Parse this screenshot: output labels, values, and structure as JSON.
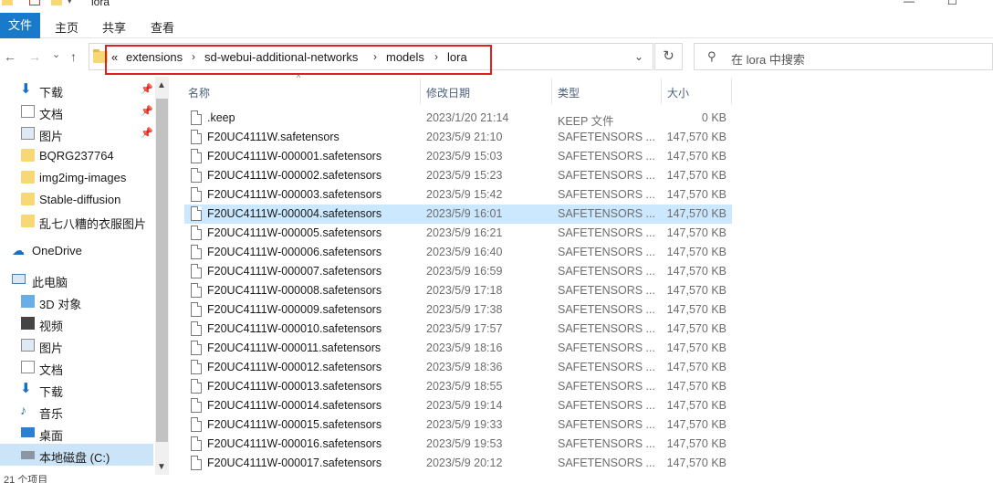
{
  "window": {
    "title": "lora",
    "minimize": "—",
    "maximize": "☐"
  },
  "ribbon": {
    "tabs": [
      "文件",
      "主页",
      "共享",
      "查看"
    ]
  },
  "nav": {
    "back": "←",
    "forward": "→",
    "recent": "⌄",
    "up": "↑",
    "breadcrumb": [
      "«",
      "extensions",
      "sd-webui-additional-networks",
      "models",
      "lora"
    ],
    "refresh": "↻",
    "search_placeholder": "在 lora 中搜索"
  },
  "sidebar": {
    "quick_access": [
      {
        "label": "下载",
        "icon": "download-icon",
        "pinned": true
      },
      {
        "label": "文档",
        "icon": "document-icon",
        "pinned": true
      },
      {
        "label": "图片",
        "icon": "picture-icon",
        "pinned": true
      },
      {
        "label": "BQRG237764",
        "icon": "folder-icon",
        "pinned": false
      },
      {
        "label": "img2img-images",
        "icon": "folder-icon",
        "pinned": false
      },
      {
        "label": "Stable-diffusion",
        "icon": "folder-icon",
        "pinned": false
      },
      {
        "label": "乱七八糟的衣服图片",
        "icon": "folder-icon",
        "pinned": false
      }
    ],
    "onedrive": "OneDrive",
    "this_pc": "此电脑",
    "pc_items": [
      {
        "label": "3D 对象",
        "icon": "3d-objects-icon"
      },
      {
        "label": "视频",
        "icon": "video-icon"
      },
      {
        "label": "图片",
        "icon": "picture-icon"
      },
      {
        "label": "文档",
        "icon": "document-icon"
      },
      {
        "label": "下载",
        "icon": "download-icon"
      },
      {
        "label": "音乐",
        "icon": "music-icon"
      },
      {
        "label": "桌面",
        "icon": "desktop-icon"
      },
      {
        "label": "本地磁盘 (C:)",
        "icon": "drive-icon"
      }
    ]
  },
  "columns": {
    "name": "名称",
    "date": "修改日期",
    "type": "类型",
    "size": "大小"
  },
  "files": [
    {
      "name": ".keep",
      "date": "2023/1/20 21:14",
      "type": "KEEP 文件",
      "size": "0 KB"
    },
    {
      "name": "F20UC4111W.safetensors",
      "date": "2023/5/9 21:10",
      "type": "SAFETENSORS ...",
      "size": "147,570 KB"
    },
    {
      "name": "F20UC4111W-000001.safetensors",
      "date": "2023/5/9 15:03",
      "type": "SAFETENSORS ...",
      "size": "147,570 KB"
    },
    {
      "name": "F20UC4111W-000002.safetensors",
      "date": "2023/5/9 15:23",
      "type": "SAFETENSORS ...",
      "size": "147,570 KB"
    },
    {
      "name": "F20UC4111W-000003.safetensors",
      "date": "2023/5/9 15:42",
      "type": "SAFETENSORS ...",
      "size": "147,570 KB"
    },
    {
      "name": "F20UC4111W-000004.safetensors",
      "date": "2023/5/9 16:01",
      "type": "SAFETENSORS ...",
      "size": "147,570 KB"
    },
    {
      "name": "F20UC4111W-000005.safetensors",
      "date": "2023/5/9 16:21",
      "type": "SAFETENSORS ...",
      "size": "147,570 KB"
    },
    {
      "name": "F20UC4111W-000006.safetensors",
      "date": "2023/5/9 16:40",
      "type": "SAFETENSORS ...",
      "size": "147,570 KB"
    },
    {
      "name": "F20UC4111W-000007.safetensors",
      "date": "2023/5/9 16:59",
      "type": "SAFETENSORS ...",
      "size": "147,570 KB"
    },
    {
      "name": "F20UC4111W-000008.safetensors",
      "date": "2023/5/9 17:18",
      "type": "SAFETENSORS ...",
      "size": "147,570 KB"
    },
    {
      "name": "F20UC4111W-000009.safetensors",
      "date": "2023/5/9 17:38",
      "type": "SAFETENSORS ...",
      "size": "147,570 KB"
    },
    {
      "name": "F20UC4111W-000010.safetensors",
      "date": "2023/5/9 17:57",
      "type": "SAFETENSORS ...",
      "size": "147,570 KB"
    },
    {
      "name": "F20UC4111W-000011.safetensors",
      "date": "2023/5/9 18:16",
      "type": "SAFETENSORS ...",
      "size": "147,570 KB"
    },
    {
      "name": "F20UC4111W-000012.safetensors",
      "date": "2023/5/9 18:36",
      "type": "SAFETENSORS ...",
      "size": "147,570 KB"
    },
    {
      "name": "F20UC4111W-000013.safetensors",
      "date": "2023/5/9 18:55",
      "type": "SAFETENSORS ...",
      "size": "147,570 KB"
    },
    {
      "name": "F20UC4111W-000014.safetensors",
      "date": "2023/5/9 19:14",
      "type": "SAFETENSORS ...",
      "size": "147,570 KB"
    },
    {
      "name": "F20UC4111W-000015.safetensors",
      "date": "2023/5/9 19:33",
      "type": "SAFETENSORS ...",
      "size": "147,570 KB"
    },
    {
      "name": "F20UC4111W-000016.safetensors",
      "date": "2023/5/9 19:53",
      "type": "SAFETENSORS ...",
      "size": "147,570 KB"
    },
    {
      "name": "F20UC4111W-000017.safetensors",
      "date": "2023/5/9 20:12",
      "type": "SAFETENSORS ...",
      "size": "147,570 KB"
    }
  ],
  "selected_file": "F20UC4111W-000004.safetensors",
  "status": "21 个项目",
  "colors": {
    "accent": "#1979ca",
    "selection": "#cce8ff",
    "highlight_box": "#e02020",
    "folder": "#f8d775"
  }
}
